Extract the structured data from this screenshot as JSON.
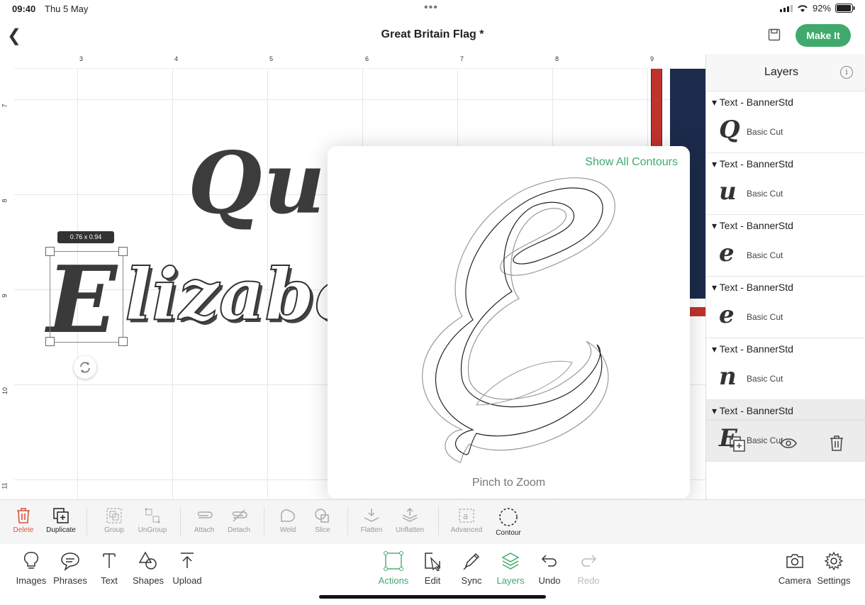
{
  "status": {
    "time": "09:40",
    "date": "Thu 5 May",
    "battery": "92%"
  },
  "header": {
    "title": "Great Britain Flag *",
    "make_it": "Make It"
  },
  "ruler": {
    "top": [
      "3",
      "4",
      "5",
      "6",
      "7",
      "8",
      "9"
    ],
    "left": [
      "7",
      "8",
      "9",
      "10",
      "11"
    ]
  },
  "canvas": {
    "size_badge": "0.76 x 0.94",
    "text_line1": "Que",
    "text_line2_first": "E",
    "text_line2_rest": "lizabe"
  },
  "popover": {
    "show_all": "Show All Contours",
    "hint": "Pinch to Zoom"
  },
  "layers": {
    "title": "Layers",
    "items": [
      {
        "name": "Text - BannerStd",
        "glyph": "Q",
        "op": "Basic Cut"
      },
      {
        "name": "Text - BannerStd",
        "glyph": "u",
        "op": "Basic Cut"
      },
      {
        "name": "Text - BannerStd",
        "glyph": "e",
        "op": "Basic Cut"
      },
      {
        "name": "Text - BannerStd",
        "glyph": "e",
        "op": "Basic Cut"
      },
      {
        "name": "Text - BannerStd",
        "glyph": "n",
        "op": "Basic Cut"
      },
      {
        "name": "Text - BannerStd",
        "glyph": "E",
        "op": "Basic Cut"
      }
    ]
  },
  "actions": [
    "Delete",
    "Duplicate",
    "Group",
    "UnGroup",
    "Attach",
    "Detach",
    "Weld",
    "Slice",
    "Flatten",
    "Unflatten",
    "Advanced",
    "Contour"
  ],
  "bottom_left": [
    "Images",
    "Phrases",
    "Text",
    "Shapes",
    "Upload"
  ],
  "bottom_mid": [
    "Actions",
    "Edit",
    "Sync",
    "Layers",
    "Undo",
    "Redo"
  ],
  "bottom_right": [
    "Camera",
    "Settings"
  ],
  "colors": {
    "accent": "#3faa6c",
    "delete": "#d9543e",
    "flag_navy": "#1c2b4b",
    "flag_red": "#c0322c"
  }
}
